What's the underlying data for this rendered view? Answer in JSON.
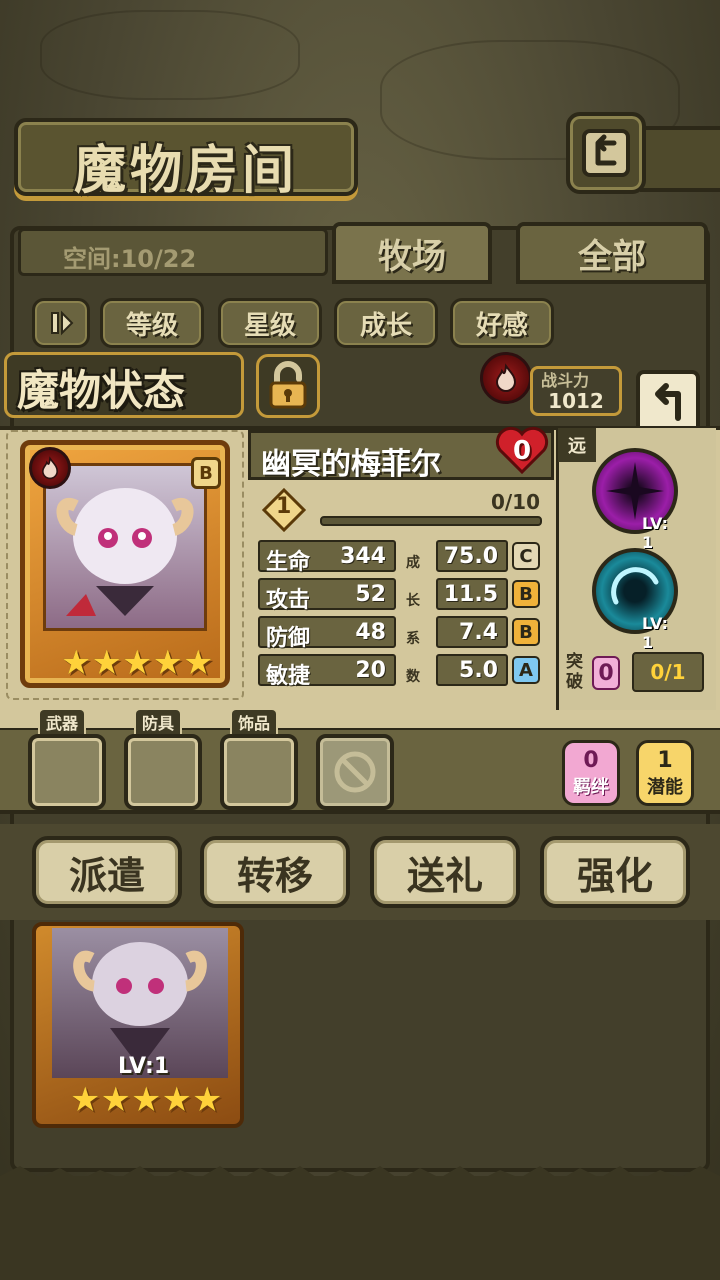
{
  "header": {
    "title": "魔物房间"
  },
  "list": {
    "space_label": "空间:10/22",
    "tabs": [
      {
        "label": "牧场"
      },
      {
        "label": "全部"
      }
    ],
    "sort_buttons": [
      {
        "label": "等级"
      },
      {
        "label": "星级"
      },
      {
        "label": "成长"
      },
      {
        "label": "好感"
      }
    ]
  },
  "status": {
    "title": "魔物状态",
    "power_label": "战斗力",
    "power_value": "1012"
  },
  "monster": {
    "name": "幽冥的梅菲尔",
    "rank": "B",
    "affection": "0",
    "level": "1",
    "exp": "0/10",
    "stars": 5,
    "stats": [
      {
        "name": "生命",
        "value": "344",
        "growth": "75.0",
        "grade": "C"
      },
      {
        "name": "攻击",
        "value": "52",
        "growth": "11.5",
        "grade": "B"
      },
      {
        "name": "防御",
        "value": "48",
        "growth": "7.4",
        "grade": "B"
      },
      {
        "name": "敏捷",
        "value": "20",
        "growth": "5.0",
        "grade": "A"
      }
    ],
    "growth_labels": [
      "成",
      "长",
      "系",
      "数"
    ],
    "range": "远",
    "skills": [
      {
        "level": "LV: 1"
      },
      {
        "level": "LV: 1"
      }
    ],
    "breakthrough_label": "突破",
    "breakthrough_value": "0",
    "breakthrough_count": "0/1"
  },
  "equipment": {
    "slots": [
      {
        "label": "武器"
      },
      {
        "label": "防具"
      },
      {
        "label": "饰品"
      }
    ],
    "bond": {
      "value": "0",
      "label": "羁绊"
    },
    "potential": {
      "value": "1",
      "label": "潜能"
    }
  },
  "actions": [
    {
      "label": "派遣"
    },
    {
      "label": "转移"
    },
    {
      "label": "送礼"
    },
    {
      "label": "强化"
    }
  ],
  "card": {
    "level": "LV:1",
    "stars": 5
  },
  "colors": {
    "gold": "#c49a3a",
    "panel": "#6a6440",
    "fire": "#9e1b1b",
    "grade_c": "#e3d8b4",
    "grade_b": "#f0b23a",
    "grade_a": "#7fc8f0"
  }
}
